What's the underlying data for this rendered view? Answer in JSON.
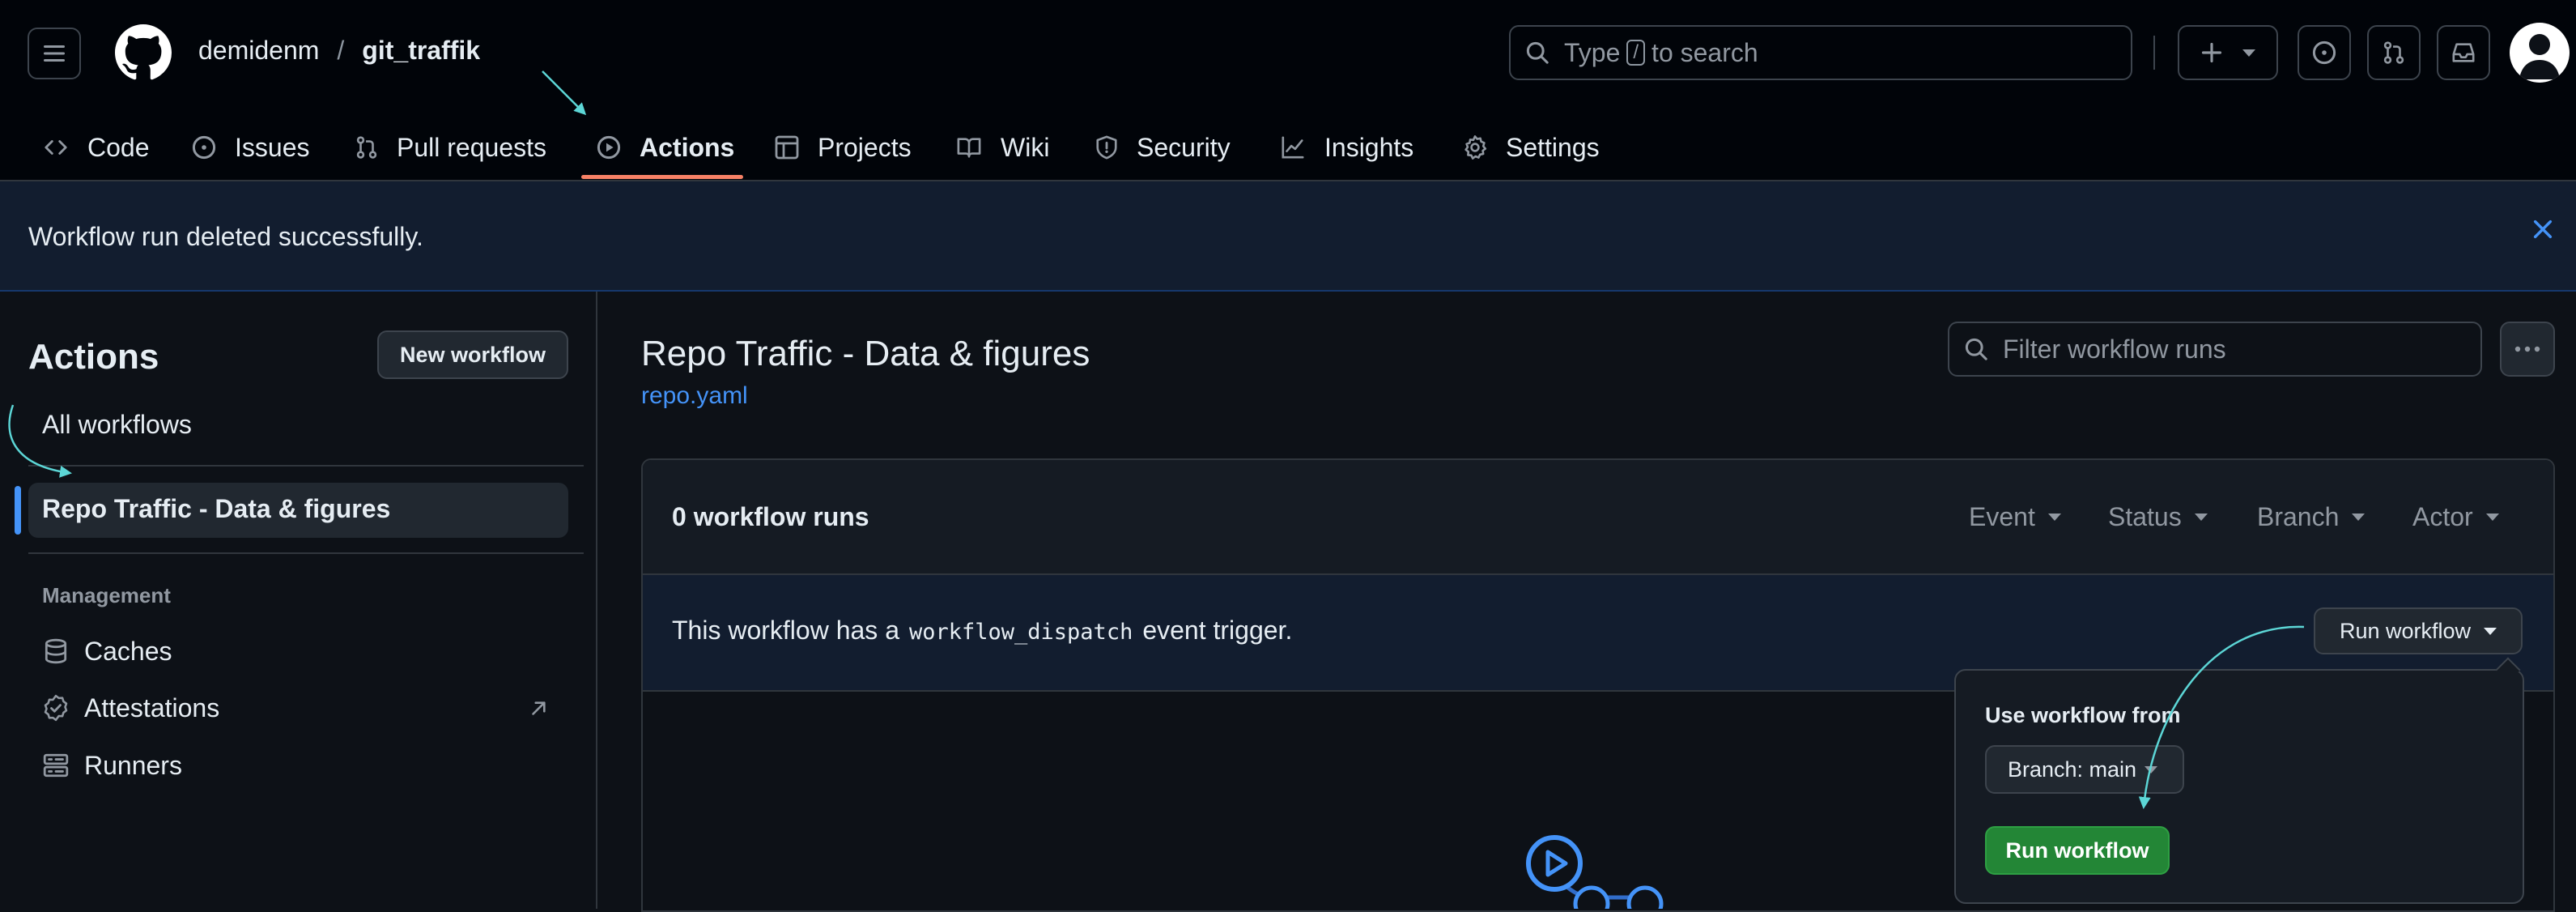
{
  "header": {
    "owner": "demidenm",
    "separator": "/",
    "repo": "git_traffik",
    "search_prefix": "Type",
    "search_key": "/",
    "search_suffix": "to search"
  },
  "nav": {
    "tabs": [
      {
        "label": "Code",
        "icon": "code-icon"
      },
      {
        "label": "Issues",
        "icon": "issue-opened-icon"
      },
      {
        "label": "Pull requests",
        "icon": "git-pull-request-icon"
      },
      {
        "label": "Actions",
        "icon": "play-icon",
        "active": true
      },
      {
        "label": "Projects",
        "icon": "table-icon"
      },
      {
        "label": "Wiki",
        "icon": "book-icon"
      },
      {
        "label": "Security",
        "icon": "shield-icon"
      },
      {
        "label": "Insights",
        "icon": "graph-icon"
      },
      {
        "label": "Settings",
        "icon": "gear-icon"
      }
    ]
  },
  "flash": {
    "message": "Workflow run deleted successfully."
  },
  "sidebar": {
    "title": "Actions",
    "new_workflow": "New workflow",
    "all_workflows": "All workflows",
    "selected_workflow": "Repo Traffic - Data & figures",
    "management_heading": "Management",
    "management_items": [
      "Caches",
      "Attestations",
      "Runners"
    ]
  },
  "main": {
    "workflow_title": "Repo Traffic - Data & figures",
    "workflow_file": "repo.yaml",
    "filter_placeholder": "Filter workflow runs",
    "runs_count": "0 workflow runs",
    "filters": [
      "Event",
      "Status",
      "Branch",
      "Actor"
    ],
    "dispatch_prefix": "This workflow has a",
    "dispatch_code": "workflow_dispatch",
    "dispatch_suffix": "event trigger.",
    "run_workflow_dropdown": "Run workflow"
  },
  "popover": {
    "heading": "Use workflow from",
    "branch_button": "Branch: main",
    "run_button": "Run workflow"
  },
  "colors": {
    "background": "#0d1117",
    "header": "#010409",
    "accent_blue": "#4493f8",
    "active_tab_underline": "#f78166",
    "run_button_green": "#238636",
    "annotation_arrow": "#5cd6d6"
  }
}
